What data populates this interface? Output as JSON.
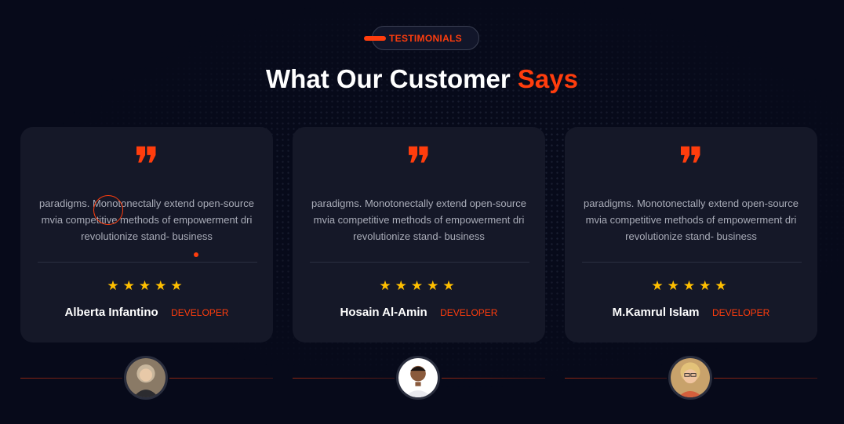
{
  "section": {
    "badge": "TESTIMONIALS",
    "title_main": "What Our Customer",
    "title_accent": "Says"
  },
  "colors": {
    "accent": "#ff3d0d",
    "star": "#ffbf00",
    "background": "#070a1a",
    "card": "#151828"
  },
  "testimonials": [
    {
      "quote_icon": "quote-icon",
      "line1": "paradigms. Monotonectally extend open-source",
      "line2": "mvia competitive methods of empowerment dri",
      "line3": "revolutionize stand- business",
      "stars": "★★★★★",
      "name": "Alberta Infantino",
      "role": "DEVELOPER"
    },
    {
      "quote_icon": "quote-icon",
      "line1": "paradigms. Monotonectally extend open-source",
      "line2": "mvia competitive methods of empowerment dri",
      "line3": "revolutionize stand- business",
      "stars": "★★★★★",
      "name": "Hosain Al-Amin",
      "role": "DEVELOPER"
    },
    {
      "quote_icon": "quote-icon",
      "line1": "paradigms. Monotonectally extend open-source",
      "line2": "mvia competitive methods of empowerment dri",
      "line3": "revolutionize stand- business",
      "stars": "★★★★★",
      "name": "M.Kamrul Islam",
      "role": "DEVELOPER"
    }
  ]
}
